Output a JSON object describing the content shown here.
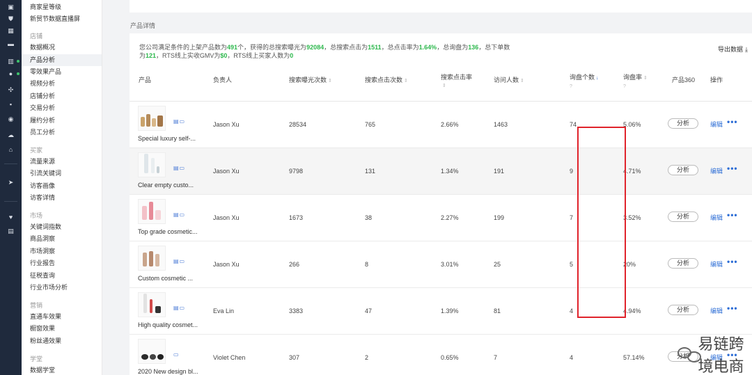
{
  "rail": {
    "icons": [
      "home-icon",
      "shield-icon",
      "grid-icon",
      "message-icon",
      "bar-chart-icon",
      "users-icon",
      "settings-icon",
      "wallet-icon",
      "clock-icon",
      "cloud-icon",
      "bank-icon",
      "send-icon",
      "heart-icon",
      "briefcase-icon"
    ]
  },
  "sidebar": {
    "top_items": [
      "商家星等级",
      "新贸节数据直播屏"
    ],
    "groups": [
      {
        "label": "店铺",
        "items": [
          "数据概况",
          "产品分析",
          "零效果产品",
          "视频分析",
          "店铺分析",
          "交易分析",
          "履约分析",
          "员工分析"
        ]
      },
      {
        "label": "买家",
        "items": [
          "流量来源",
          "引流关键词",
          "访客画像",
          "访客详情"
        ]
      },
      {
        "label": "市场",
        "items": [
          "关键词指数",
          "商品洞察",
          "市场洞察",
          "行业报告",
          "征税查询",
          "行业市场分析"
        ]
      },
      {
        "label": "营销",
        "items": [
          "直通车效果",
          "橱窗效果",
          "粉丝通效果"
        ]
      },
      {
        "label": "学堂",
        "items": [
          "数据学堂"
        ]
      }
    ],
    "active": "产品分析"
  },
  "section_title": "产品详情",
  "summary": {
    "p1": "您公司满足条件的上架产品数为",
    "v1": "491",
    "p2": "个，获得的总搜索曝光为",
    "v2": "92084",
    "p3": "，总搜索点击为",
    "v3": "1511",
    "p4": "，总点击率为",
    "v4": "1.64%",
    "p5": "，总询盘为",
    "v5": "136",
    "p6": "，总下单数为",
    "v6": "121",
    "p7": "，RTS线上实收GMV为",
    "v7": "$0",
    "p8": "，RTS线上买家人数为",
    "v8": "0"
  },
  "export_label": "导出数据",
  "columns": {
    "product": "产品",
    "owner": "负责人",
    "impressions": "搜索曝光次数",
    "clicks": "搜索点击次数",
    "ctr": "搜索点击率",
    "visitors": "访问人数",
    "inquiries": "询盘个数",
    "inquiry_rate": "询盘率",
    "p360": "产品360",
    "action": "操作"
  },
  "rows": [
    {
      "title": "Special luxury self-...",
      "owner": "Jason Xu",
      "impressions": "28534",
      "clicks": "765",
      "ctr": "2.66%",
      "visitors": "1463",
      "inquiries": "74",
      "rate": "5.06%",
      "analyze": "分析",
      "edit": "编辑"
    },
    {
      "title": "Clear empty custo...",
      "owner": "Jason Xu",
      "impressions": "9798",
      "clicks": "131",
      "ctr": "1.34%",
      "visitors": "191",
      "inquiries": "9",
      "rate": "4.71%",
      "analyze": "分析",
      "edit": "编辑"
    },
    {
      "title": "Top grade cosmetic...",
      "owner": "Jason Xu",
      "impressions": "1673",
      "clicks": "38",
      "ctr": "2.27%",
      "visitors": "199",
      "inquiries": "7",
      "rate": "3.52%",
      "analyze": "分析",
      "edit": "编辑"
    },
    {
      "title": "Custom cosmetic ...",
      "owner": "Jason Xu",
      "impressions": "266",
      "clicks": "8",
      "ctr": "3.01%",
      "visitors": "25",
      "inquiries": "5",
      "rate": "20%",
      "analyze": "分析",
      "edit": "编辑"
    },
    {
      "title": "High quality cosmet...",
      "owner": "Eva Lin",
      "impressions": "3383",
      "clicks": "47",
      "ctr": "1.39%",
      "visitors": "81",
      "inquiries": "4",
      "rate": "4.94%",
      "analyze": "分析",
      "edit": "编辑"
    },
    {
      "title": "2020 New design bl...",
      "owner": "Violet Chen",
      "impressions": "307",
      "clicks": "2",
      "ctr": "0.65%",
      "visitors": "7",
      "inquiries": "4",
      "rate": "57.14%",
      "analyze": "分析",
      "edit": "编辑"
    }
  ],
  "watermark": "易链跨境电商",
  "colors": {
    "highlight_box": "#e0232b",
    "summary_values": "#2db84d",
    "link": "#2f6fd6"
  }
}
